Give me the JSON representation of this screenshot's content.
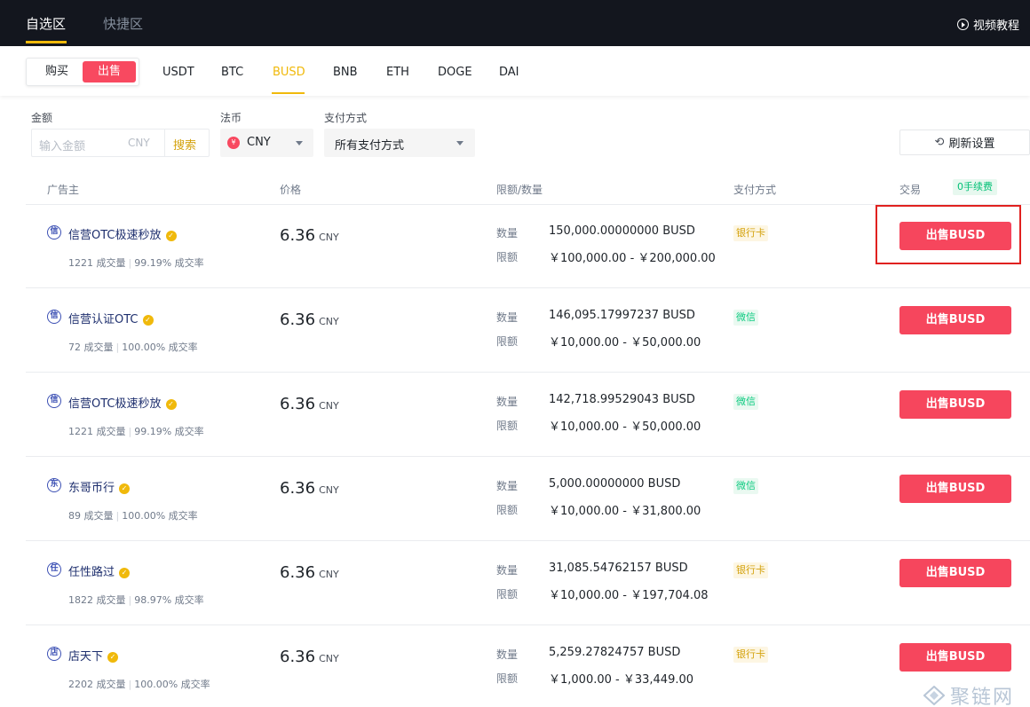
{
  "header": {
    "tabs": [
      {
        "label": "自选区",
        "active": true
      },
      {
        "label": "快捷区",
        "active": false
      }
    ],
    "video_link": "视频教程"
  },
  "trade_toggle": {
    "buy": "购买",
    "sell": "出售",
    "active": "sell"
  },
  "coins": [
    {
      "label": "USDT",
      "active": false
    },
    {
      "label": "BTC",
      "active": false
    },
    {
      "label": "BUSD",
      "active": true
    },
    {
      "label": "BNB",
      "active": false
    },
    {
      "label": "ETH",
      "active": false
    },
    {
      "label": "DOGE",
      "active": false
    },
    {
      "label": "DAI",
      "active": false
    }
  ],
  "filters": {
    "amount_label": "金额",
    "amount_placeholder": "输入金额",
    "amount_unit": "CNY",
    "search_label": "搜索",
    "fiat_label": "法币",
    "fiat_icon": "¥",
    "fiat_value": "CNY",
    "payment_label": "支付方式",
    "payment_value": "所有支付方式",
    "refresh_label": "刷新设置"
  },
  "columns": {
    "advertiser": "广告主",
    "price": "价格",
    "limit_qty": "限额/数量",
    "payment": "支付方式",
    "trade": "交易",
    "fee_badge": "0手续费"
  },
  "labels": {
    "quantity": "数量",
    "limit": "限额",
    "unit": "CNY"
  },
  "ads": [
    {
      "avatar": "信",
      "name": "信营OTC极速秒放",
      "orders": "1221 成交量",
      "rate": "99.19% 成交率",
      "price": "6.36",
      "quantity": "150,000.00000000 BUSD",
      "limit": "￥100,000.00 - ￥200,000.00",
      "payment": "银行卡",
      "payment_type": "bank",
      "button": "出售BUSD"
    },
    {
      "avatar": "信",
      "name": "信营认证OTC",
      "orders": "72 成交量",
      "rate": "100.00% 成交率",
      "price": "6.36",
      "quantity": "146,095.17997237 BUSD",
      "limit": "￥10,000.00 - ￥50,000.00",
      "payment": "微信",
      "payment_type": "wechat",
      "button": "出售BUSD"
    },
    {
      "avatar": "信",
      "name": "信营OTC极速秒放",
      "orders": "1221 成交量",
      "rate": "99.19% 成交率",
      "price": "6.36",
      "quantity": "142,718.99529043 BUSD",
      "limit": "￥10,000.00 - ￥50,000.00",
      "payment": "微信",
      "payment_type": "wechat",
      "button": "出售BUSD"
    },
    {
      "avatar": "东",
      "name": "东哥币行",
      "orders": "89 成交量",
      "rate": "100.00% 成交率",
      "price": "6.36",
      "quantity": "5,000.00000000 BUSD",
      "limit": "￥10,000.00 - ￥31,800.00",
      "payment": "微信",
      "payment_type": "wechat",
      "button": "出售BUSD"
    },
    {
      "avatar": "任",
      "name": "任性路过",
      "orders": "1822 成交量",
      "rate": "98.97% 成交率",
      "price": "6.36",
      "quantity": "31,085.54762157 BUSD",
      "limit": "￥10,000.00 - ￥197,704.08",
      "payment": "银行卡",
      "payment_type": "bank",
      "button": "出售BUSD"
    },
    {
      "avatar": "店",
      "name": "店天下",
      "orders": "2202 成交量",
      "rate": "100.00% 成交率",
      "price": "6.36",
      "quantity": "5,259.27824757 BUSD",
      "limit": "￥1,000.00 - ￥33,449.00",
      "payment": "银行卡",
      "payment_type": "bank",
      "button": "出售BUSD"
    }
  ],
  "watermark": "聚链网"
}
